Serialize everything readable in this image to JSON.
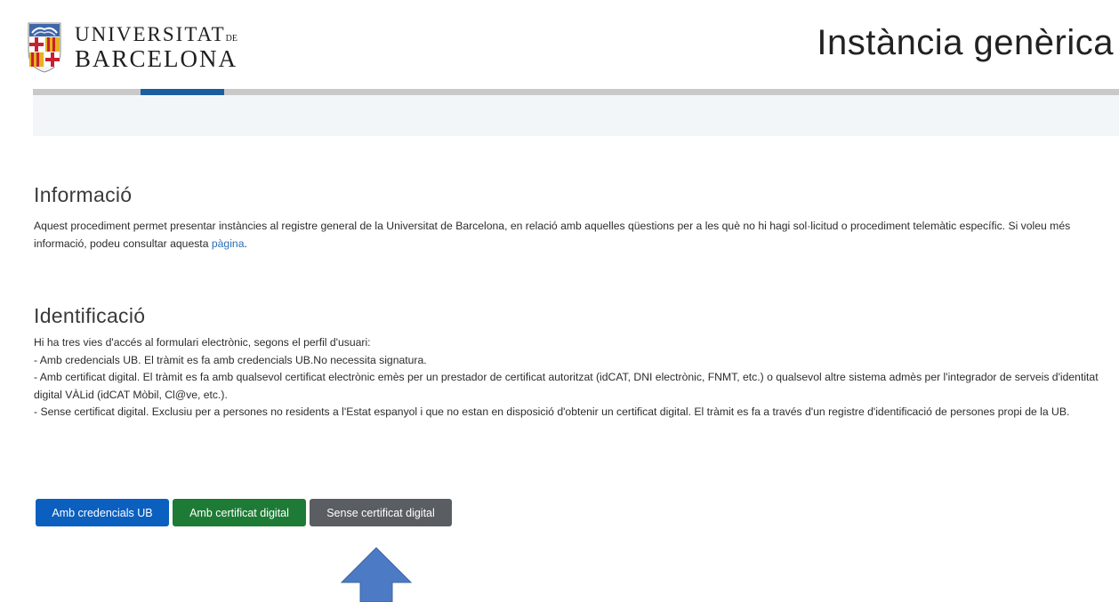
{
  "header": {
    "logo_line1_main": "UNIVERSITAT",
    "logo_line1_small": "DE",
    "logo_line2": "BARCELONA",
    "page_title": "Instància genèrica"
  },
  "colors": {
    "accent_blue": "#1b5ea0",
    "button_blue": "#0a5fbf",
    "button_green": "#1e7b36",
    "button_gray": "#5a5d62",
    "arrow_blue": "#4c7ac4"
  },
  "informacio": {
    "title": "Informació",
    "text_before_link": "Aquest procediment permet presentar instàncies al registre general de la Universitat de Barcelona, en relació amb aquelles qüestions per a les què no hi hagi sol·licitud o procediment telemàtic específic. Si voleu més informació, podeu consultar aquesta ",
    "link_text": "pàgina",
    "text_after_link": "."
  },
  "identificacio": {
    "title": "Identificació",
    "lines": [
      "Hi ha tres vies d'accés al formulari electrònic, segons el perfil d'usuari:",
      "- Amb credencials UB. El tràmit es fa amb credencials UB.No necessita signatura.",
      "- Amb certificat digital. El tràmit es fa amb qualsevol certificat electrònic emès per un prestador de certificat autoritzat (idCAT, DNI electrònic, FNMT, etc.) o qualsevol altre sistema admès per l'integrador de serveis d'identitat digital VÀLid (idCAT Mòbil, Cl@ve, etc.).",
      "- Sense certificat digital. Exclusiu per a persones no residents a l'Estat espanyol i que no estan en disposició d'obtenir un certificat digital. El tràmit es fa a través d'un registre d'identificació de persones propi de la UB."
    ]
  },
  "buttons": {
    "credencials": "Amb credencials UB",
    "certificat": "Amb certificat digital",
    "sense_certificat": "Sense certificat digital"
  }
}
